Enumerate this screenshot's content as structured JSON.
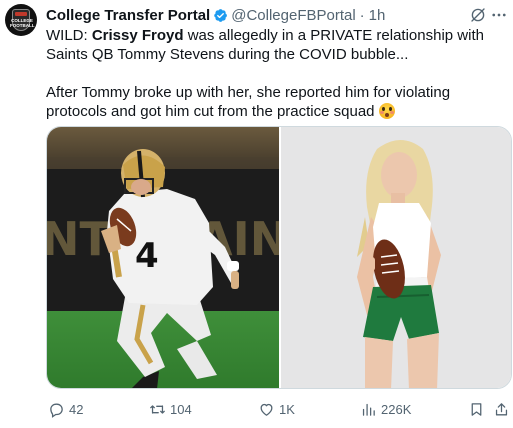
{
  "author": {
    "name": "College Transfer Portal",
    "handle": "@CollegeFBPortal",
    "separator": "·",
    "time": "1h",
    "avatar_text": "COLLEGE FOOTBALL"
  },
  "tweet": {
    "line1_prefix": "WILD: ",
    "line1_bold": "Crissy Froyd",
    "line1_rest": " was allegedly in a PRIVATE relationship with Saints QB Tommy Stevens during the COVID bubble...",
    "para2": "After Tommy broke up with her, she reported him for violating protocols and got him cut from the practice squad"
  },
  "stats": {
    "replies": "42",
    "reposts": "104",
    "likes": "1K",
    "views": "226K"
  },
  "colors": {
    "verified": "#1d9bf0",
    "muted": "#536471",
    "text": "#0f1419"
  },
  "icons": [
    "verified-badge-icon",
    "grok-icon",
    "more-icon",
    "reply-icon",
    "repost-icon",
    "like-icon",
    "views-icon",
    "bookmark-icon",
    "share-icon"
  ]
}
